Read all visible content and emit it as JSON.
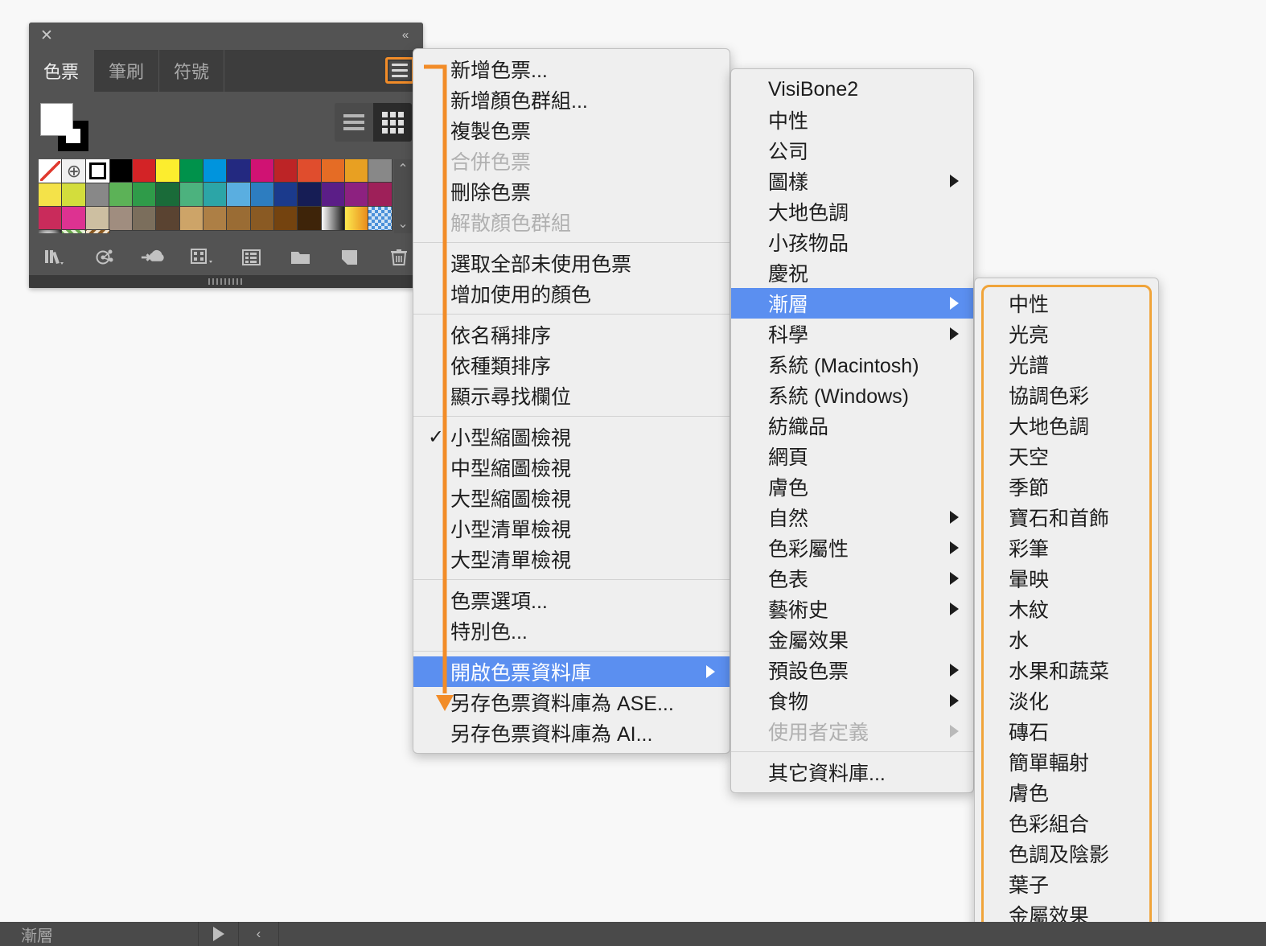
{
  "panel": {
    "close_label": "✕",
    "collapse_label": "«",
    "tabs": [
      {
        "label": "色票",
        "active": true
      },
      {
        "label": "筆刷",
        "active": false
      },
      {
        "label": "符號",
        "active": false
      }
    ],
    "menu_button_name": "hamburger-icon",
    "view_toggle": [
      {
        "name": "list-view-icon",
        "active": false
      },
      {
        "name": "grid-view-icon",
        "active": true
      }
    ],
    "footer_icons": [
      "swatch-libraries-icon",
      "color-group-icon",
      "add-to-library-icon",
      "show-swatch-kinds-icon",
      "swatch-options-icon",
      "new-color-group-icon",
      "new-swatch-icon",
      "delete-swatch-icon"
    ],
    "scroll_up": "⌃",
    "scroll_down": "⌄",
    "swatches": [
      {
        "type": "none"
      },
      {
        "type": "registration"
      },
      {
        "type": "white"
      },
      {
        "color": "#000000"
      },
      {
        "color": "#d32326"
      },
      {
        "color": "#fced2e"
      },
      {
        "color": "#00924b"
      },
      {
        "color": "#0094dd"
      },
      {
        "color": "#232980"
      },
      {
        "color": "#d01273"
      },
      {
        "color": "#bd2426"
      },
      {
        "color": "#e04d2d"
      },
      {
        "color": "#e56c25"
      },
      {
        "color": "#e8a022"
      },
      {
        "color": "#eeb martin"
      },
      {
        "color": "#f4e249"
      },
      {
        "color": "#d3dd3c"
      },
      {
        "color": "#8dc councils"
      },
      {
        "color": "#5cb257"
      },
      {
        "color": "#2f9b49"
      },
      {
        "color": "#1a6b39"
      },
      {
        "color": "#4cb27e"
      },
      {
        "color": "#2ca5a7"
      },
      {
        "color": "#5aaee0"
      },
      {
        "color": "#2d7dc0"
      },
      {
        "color": "#1b3a8c"
      },
      {
        "color": "#161d55"
      },
      {
        "color": "#5b1e87"
      },
      {
        "color": "#8d2180"
      },
      {
        "color": "#9e2059"
      },
      {
        "color": "#c92b5b"
      },
      {
        "color": "#dd3291"
      },
      {
        "color": "#cdbfa1"
      },
      {
        "color": "#a08d7f"
      },
      {
        "color": "#7b6e5c"
      },
      {
        "color": "#5a4331"
      },
      {
        "color": "#cda468"
      },
      {
        "color": "#ad7f45"
      },
      {
        "color": "#9a6c34"
      },
      {
        "color": "#8a5a23"
      },
      {
        "color": "#74430f"
      },
      {
        "color": "#3e2409"
      },
      {
        "type": "gradient-bw"
      },
      {
        "type": "gradient-yellow"
      },
      {
        "type": "pattern-blue"
      },
      {
        "type": "pattern-sphere"
      },
      {
        "type": "pattern-leaves"
      },
      {
        "type": "pattern-scroll"
      }
    ]
  },
  "menu1": {
    "name": "swatches-panel-menu",
    "items": [
      {
        "label": "新增色票...",
        "state": "normal"
      },
      {
        "label": "新增顏色群組...",
        "state": "normal"
      },
      {
        "label": "複製色票",
        "state": "normal"
      },
      {
        "label": "合併色票",
        "state": "disabled"
      },
      {
        "label": "刪除色票",
        "state": "normal"
      },
      {
        "label": "解散顏色群組",
        "state": "disabled"
      },
      {
        "separator": true
      },
      {
        "label": "選取全部未使用色票",
        "state": "normal"
      },
      {
        "label": "增加使用的顏色",
        "state": "normal"
      },
      {
        "separator": true
      },
      {
        "label": "依名稱排序",
        "state": "normal"
      },
      {
        "label": "依種類排序",
        "state": "normal"
      },
      {
        "label": "顯示尋找欄位",
        "state": "normal"
      },
      {
        "separator": true
      },
      {
        "label": "小型縮圖檢視",
        "state": "normal",
        "checked": true
      },
      {
        "label": "中型縮圖檢視",
        "state": "normal"
      },
      {
        "label": "大型縮圖檢視",
        "state": "normal"
      },
      {
        "label": "小型清單檢視",
        "state": "normal"
      },
      {
        "label": "大型清單檢視",
        "state": "normal"
      },
      {
        "separator": true
      },
      {
        "label": "色票選項...",
        "state": "normal"
      },
      {
        "label": "特別色...",
        "state": "normal"
      },
      {
        "separator": true
      },
      {
        "label": "開啟色票資料庫",
        "state": "selected",
        "submenu": true
      },
      {
        "label": "另存色票資料庫為 ASE...",
        "state": "normal"
      },
      {
        "label": "另存色票資料庫為 AI...",
        "state": "normal"
      }
    ]
  },
  "menu2": {
    "name": "swatch-libraries-menu",
    "items": [
      {
        "label": "VisiBone2",
        "state": "normal"
      },
      {
        "label": "中性",
        "state": "normal"
      },
      {
        "label": "公司",
        "state": "normal"
      },
      {
        "label": "圖樣",
        "state": "normal",
        "submenu": true
      },
      {
        "label": "大地色調",
        "state": "normal"
      },
      {
        "label": "小孩物品",
        "state": "normal"
      },
      {
        "label": "慶祝",
        "state": "normal"
      },
      {
        "label": "漸層",
        "state": "selected",
        "submenu": true
      },
      {
        "label": "科學",
        "state": "normal",
        "submenu": true
      },
      {
        "label": "系統 (Macintosh)",
        "state": "normal"
      },
      {
        "label": "系統 (Windows)",
        "state": "normal"
      },
      {
        "label": "紡織品",
        "state": "normal"
      },
      {
        "label": "網頁",
        "state": "normal"
      },
      {
        "label": "膚色",
        "state": "normal"
      },
      {
        "label": "自然",
        "state": "normal",
        "submenu": true
      },
      {
        "label": "色彩屬性",
        "state": "normal",
        "submenu": true
      },
      {
        "label": "色表",
        "state": "normal",
        "submenu": true
      },
      {
        "label": "藝術史",
        "state": "normal",
        "submenu": true
      },
      {
        "label": "金屬效果",
        "state": "normal"
      },
      {
        "label": "預設色票",
        "state": "normal",
        "submenu": true
      },
      {
        "label": "食物",
        "state": "normal",
        "submenu": true
      },
      {
        "label": "使用者定義",
        "state": "disabled",
        "submenu": true
      },
      {
        "separator": true
      },
      {
        "label": "其它資料庫...",
        "state": "normal"
      }
    ]
  },
  "menu3": {
    "name": "gradients-submenu",
    "items": [
      {
        "label": "中性"
      },
      {
        "label": "光亮"
      },
      {
        "label": "光譜"
      },
      {
        "label": "協調色彩"
      },
      {
        "label": "大地色調"
      },
      {
        "label": "天空"
      },
      {
        "label": "季節"
      },
      {
        "label": "寶石和首飾"
      },
      {
        "label": "彩筆"
      },
      {
        "label": "暈映"
      },
      {
        "label": "木紋"
      },
      {
        "label": "水"
      },
      {
        "label": "水果和蔬菜"
      },
      {
        "label": "淡化"
      },
      {
        "label": "磚石"
      },
      {
        "label": "簡單輻射"
      },
      {
        "label": "膚色"
      },
      {
        "label": "色彩組合"
      },
      {
        "label": "色調及陰影"
      },
      {
        "label": "葉子"
      },
      {
        "label": "金屬效果"
      }
    ]
  },
  "statusbar": {
    "tab_label": "漸層",
    "play_icon": "play-triangle-icon",
    "back_icon": "chevron-left-icon",
    "back_label": "‹"
  },
  "colors": {
    "accent_orange": "#f0a43a",
    "menu_highlight_blue": "#5b8ff0",
    "panel_bg": "#535353",
    "menu_bg": "#efefef"
  }
}
